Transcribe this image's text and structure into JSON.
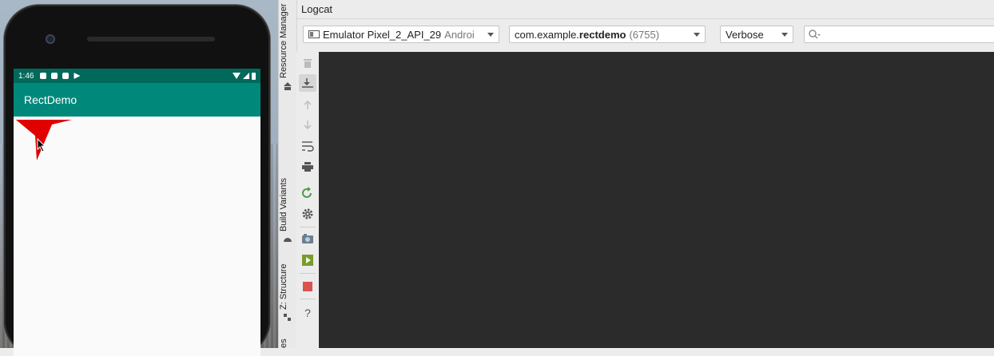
{
  "emulator": {
    "status_time": "1:46",
    "app_title": "RectDemo",
    "shape_color": "#e00000"
  },
  "tool_windows": {
    "resource_manager": "Resource Manager",
    "build_variants": "Build Variants",
    "structure": "Z: Structure",
    "favorites_partial": "es"
  },
  "logcat": {
    "title": "Logcat",
    "device": {
      "name": "Emulator Pixel_2_API_29",
      "suffix": "Androi"
    },
    "process": {
      "prefix": "com.example.",
      "bold": "rectdemo",
      "pid": "(6755)"
    },
    "level": "Verbose",
    "search_placeholder": "",
    "toolbar_icons": [
      "trash-icon",
      "scroll-to-end-icon",
      "up-arrow-icon",
      "down-arrow-icon",
      "soft-wrap-icon",
      "print-icon",
      "restart-icon",
      "settings-icon",
      "screenshot-icon",
      "screen-record-icon",
      "stop-icon",
      "help-icon"
    ],
    "help_glyph": "?"
  },
  "colors": {
    "status_bar": "#00695c",
    "app_bar": "#00897b",
    "log_background": "#2b2b2b"
  }
}
